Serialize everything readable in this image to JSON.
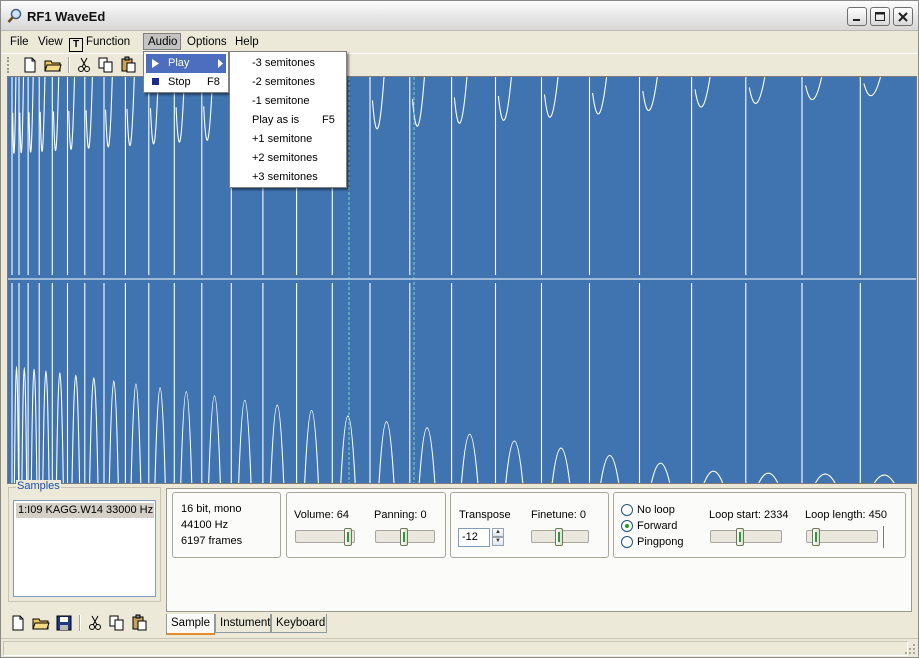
{
  "window": {
    "title": "RF1 WaveEd"
  },
  "menubar": {
    "items": [
      "File",
      "View",
      "Function",
      "Audio",
      "Options",
      "Help"
    ],
    "function_icon_glyph": "T",
    "active": "Audio"
  },
  "audio_menu": {
    "items": [
      {
        "label": "Play",
        "shortcut": "",
        "icon": "play-triangle-icon",
        "submenu": true
      },
      {
        "label": "Stop",
        "shortcut": "F8",
        "icon": "stop-square-icon",
        "submenu": false
      }
    ]
  },
  "play_submenu": {
    "items": [
      {
        "label": "-3 semitones",
        "shortcut": ""
      },
      {
        "label": "-2 semitones",
        "shortcut": ""
      },
      {
        "label": "-1 semitone",
        "shortcut": ""
      },
      {
        "label": "Play as is",
        "shortcut": "F5"
      },
      {
        "label": "+1 semitone",
        "shortcut": ""
      },
      {
        "label": "+2 semitones",
        "shortcut": ""
      },
      {
        "label": "+3 semitones",
        "shortcut": ""
      }
    ]
  },
  "toolbar": {
    "icons": [
      "new-file-icon",
      "open-folder-icon",
      "cut-icon",
      "copy-icon",
      "paste-icon"
    ]
  },
  "samples": {
    "title": "Samples",
    "items": [
      "1:I09 KAGG.W14 33000 Hz"
    ]
  },
  "info": {
    "format": "16 bit, mono",
    "rate": "44100 Hz",
    "frames": "6197 frames"
  },
  "volume": {
    "label": "Volume: 64",
    "level": 1.0
  },
  "panning": {
    "label": "Panning: 0",
    "level": 0.5
  },
  "transpose": {
    "label": "Transpose",
    "value": "-12"
  },
  "finetune": {
    "label": "Finetune: 0",
    "level": 0.5
  },
  "loop": {
    "options": [
      "No loop",
      "Forward",
      "Pingpong"
    ],
    "selected": "Forward",
    "start_label": "Loop start: 2334",
    "start_level": 0.42,
    "length_label": "Loop length: 450",
    "length_level": 0.08
  },
  "tabs": [
    "Sample",
    "Instument",
    "Keyboard"
  ],
  "active_tab": "Sample",
  "colors": {
    "wave_bg": "#3f74b0",
    "wave_line": "#ffffff",
    "marker": "#7ad8c0",
    "menu_highlight": "#4d6dbf"
  }
}
